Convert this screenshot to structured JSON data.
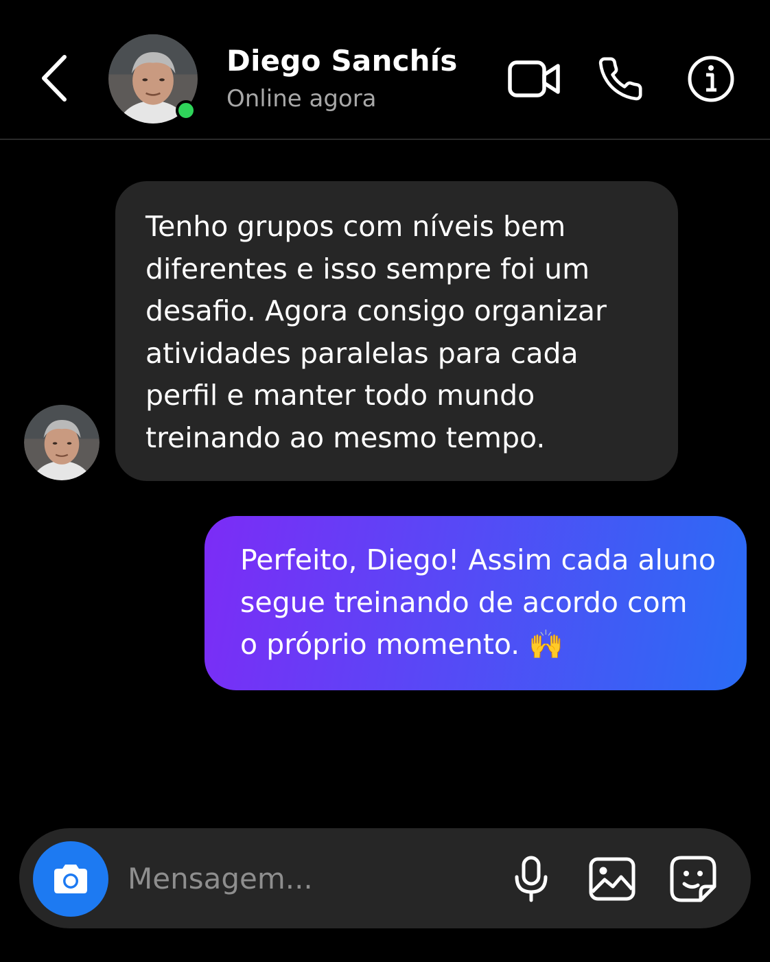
{
  "colors": {
    "background": "#000000",
    "incoming_bubble": "#262626",
    "outgoing_gradient_start": "#7c2cf6",
    "outgoing_gradient_end": "#2a6cf5",
    "online": "#2fd45a",
    "camera_button": "#1d7af2",
    "secondary_text": "#a8a8a8",
    "placeholder": "#8e8e8e"
  },
  "header": {
    "back_icon": "chevron-left-icon",
    "contact_name": "Diego Sanchís",
    "status": "Online agora",
    "actions": [
      "video-camera-icon",
      "phone-icon",
      "info-icon"
    ]
  },
  "messages": [
    {
      "direction": "incoming",
      "lines": [
        "Tenho grupos com níveis bem",
        "diferentes e isso sempre foi um",
        "desafio. Agora consigo organizar",
        "atividades paralelas para cada",
        "perfil e manter todo mundo",
        "treinando ao mesmo tempo."
      ]
    },
    {
      "direction": "outgoing",
      "lines": [
        "Perfeito, Diego! Assim cada aluno",
        "segue treinando de acordo com",
        "o próprio momento. 🙌"
      ]
    }
  ],
  "composer": {
    "placeholder": "Mensagem...",
    "value": "",
    "icons": [
      "camera-icon",
      "microphone-icon",
      "image-icon",
      "sticker-icon"
    ]
  }
}
